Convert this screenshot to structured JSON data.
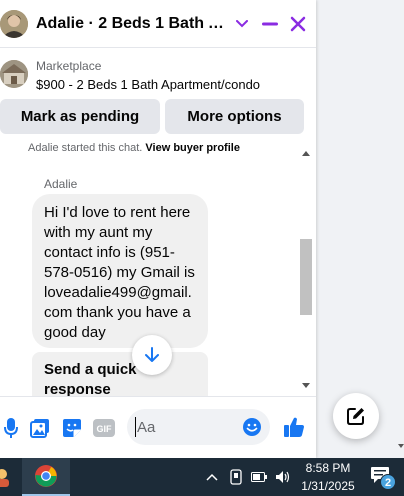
{
  "chat": {
    "title": "Adalie · 2 Beds 1 Bath Apar...",
    "listing": {
      "label": "Marketplace",
      "title": "$900 - 2 Beds 1 Bath Apartment/condo"
    },
    "buttons": {
      "mark_pending": "Mark as pending",
      "more_options": "More options"
    },
    "thread": {
      "started_text": "Adalie started this chat.",
      "view_profile": "View buyer profile",
      "sender": "Adalie",
      "message": "Hi I'd love to rent here with my aunt my contact info is (951-578-0516) my Gmail is loveadalie499@gmail.com thank you have a good day",
      "quick_response": "Send a quick response"
    },
    "composer": {
      "placeholder": "Aa",
      "icons": [
        "mic-icon",
        "photo-icon",
        "sticker-icon",
        "gif-icon",
        "emoji-icon",
        "like-icon"
      ],
      "gif_label": "GIF"
    }
  },
  "taskbar": {
    "time": "8:58 PM",
    "date": "1/31/2025",
    "notification_count": "2"
  },
  "colors": {
    "accent": "#1877f2",
    "header_controls": "#8a2be2",
    "taskbar": "#1c2b38"
  }
}
